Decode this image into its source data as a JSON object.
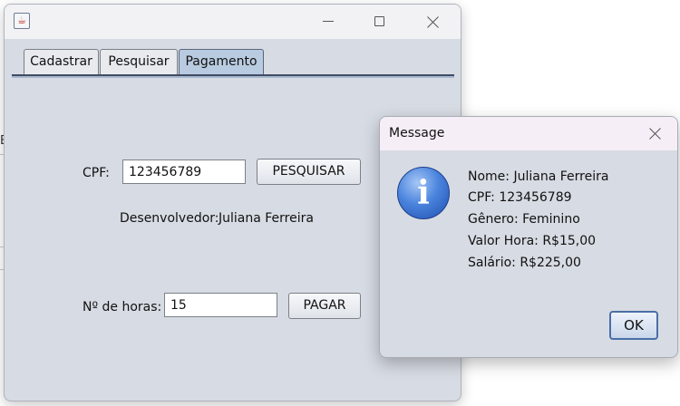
{
  "desktop": {
    "edge_glyph": "E"
  },
  "window": {
    "icon": "java-cup-icon",
    "controls": {
      "minimize": "minimize-icon",
      "maximize": "maximize-icon",
      "close": "close-icon"
    }
  },
  "tabs": [
    {
      "label": "Cadastrar",
      "selected": false
    },
    {
      "label": "Pesquisar",
      "selected": false
    },
    {
      "label": "Pagamento",
      "selected": true
    }
  ],
  "form": {
    "cpf_label": "CPF:",
    "cpf_value": "123456789",
    "search_button": "PESQUISAR",
    "developer_label": "Desenvolvedor:",
    "developer_name": "Juliana Ferreira",
    "hours_label": "Nº de horas:",
    "hours_value": "15",
    "pay_button": "PAGAR"
  },
  "dialog": {
    "title": "Message",
    "icon": "information-icon",
    "icon_glyph": "i",
    "lines": [
      "Nome: Juliana Ferreira",
      "CPF: 123456789",
      "Gênero: Feminino",
      "Valor Hora: R$15,00",
      "Salário: R$225,00"
    ],
    "ok_button": "OK"
  }
}
